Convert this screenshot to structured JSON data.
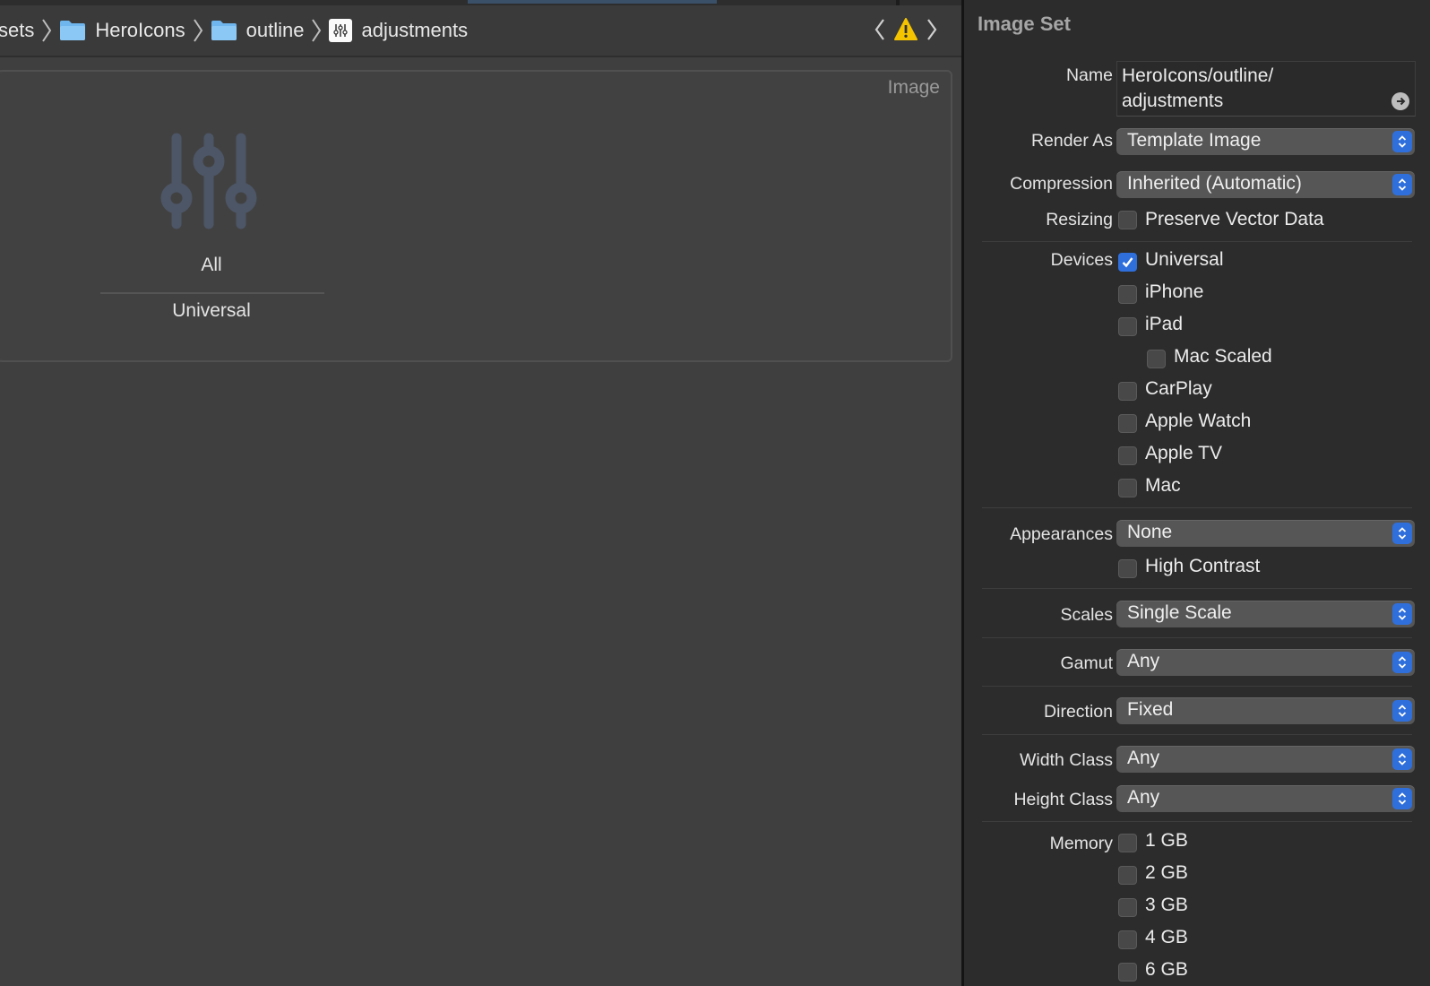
{
  "breadcrumbs": [
    {
      "label": "sets",
      "kind": "text"
    },
    {
      "label": "HeroIcons",
      "kind": "folder"
    },
    {
      "label": "outline",
      "kind": "folder"
    },
    {
      "label": "adjustments",
      "kind": "asset"
    }
  ],
  "navigation": {
    "back_icon": "chevron-left-icon",
    "warning_icon": "warning-triangle-icon",
    "forward_icon": "chevron-right-icon"
  },
  "image_set": {
    "label": "Image",
    "slot_icon": "adjustments-icon",
    "slot_title": "All",
    "slot_subtitle": "Universal"
  },
  "inspector": {
    "title": "Image Set",
    "name_label": "Name",
    "name_value_line1": "HeroIcons/outline/",
    "name_value_line2": "adjustments",
    "render_as_label": "Render As",
    "render_as_value": "Template Image",
    "compression_label": "Compression",
    "compression_value": "Inherited (Automatic)",
    "resizing_label": "Resizing",
    "preserve_vector": {
      "label": "Preserve Vector Data",
      "checked": false
    },
    "devices_label": "Devices",
    "devices": [
      {
        "label": "Universal",
        "checked": true
      },
      {
        "label": "iPhone",
        "checked": false
      },
      {
        "label": "iPad",
        "checked": false
      },
      {
        "label": "Mac Scaled",
        "checked": false
      },
      {
        "label": "CarPlay",
        "checked": false
      },
      {
        "label": "Apple Watch",
        "checked": false
      },
      {
        "label": "Apple TV",
        "checked": false
      },
      {
        "label": "Mac",
        "checked": false
      }
    ],
    "appearances_label": "Appearances",
    "appearances_value": "None",
    "high_contrast": {
      "label": "High Contrast",
      "checked": false
    },
    "scales_label": "Scales",
    "scales_value": "Single Scale",
    "gamut_label": "Gamut",
    "gamut_value": "Any",
    "direction_label": "Direction",
    "direction_value": "Fixed",
    "width_class_label": "Width Class",
    "width_class_value": "Any",
    "height_class_label": "Height Class",
    "height_class_value": "Any",
    "memory_label": "Memory",
    "memory": [
      {
        "label": "1 GB",
        "checked": false
      },
      {
        "label": "2 GB",
        "checked": false
      },
      {
        "label": "3 GB",
        "checked": false
      },
      {
        "label": "4 GB",
        "checked": false
      },
      {
        "label": "6 GB",
        "checked": false
      }
    ]
  },
  "colors": {
    "accent": "#2f6fdc",
    "warning": "#f5c400",
    "folder": "#6fb6ee",
    "slot_icon": "#4d5666"
  }
}
